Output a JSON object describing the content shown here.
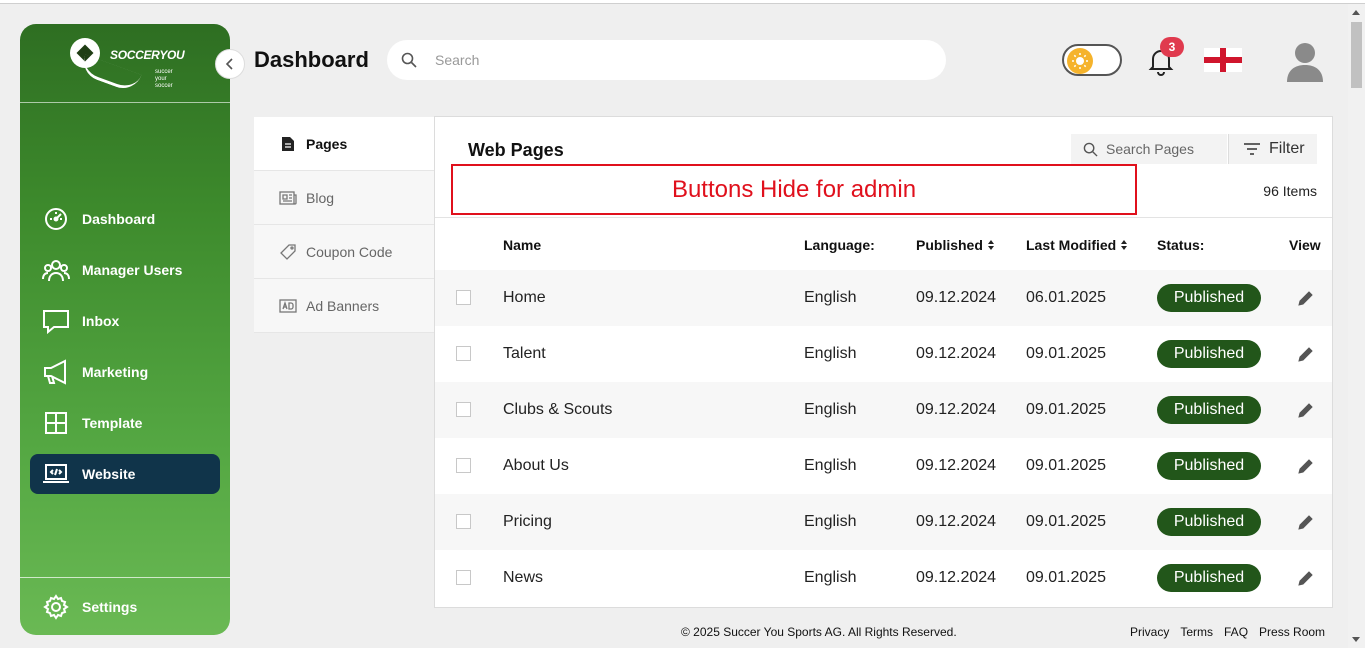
{
  "brand": {
    "logo_text": "SOCCERYOU",
    "tagline": "succer your soccer"
  },
  "sidebar": {
    "items": [
      {
        "label": "Dashboard",
        "icon": "gauge-icon"
      },
      {
        "label": "Manager Users",
        "icon": "users-icon"
      },
      {
        "label": "Inbox",
        "icon": "chat-icon"
      },
      {
        "label": "Marketing",
        "icon": "megaphone-icon"
      },
      {
        "label": "Template",
        "icon": "grid-icon"
      },
      {
        "label": "Website",
        "icon": "code-laptop-icon",
        "active": true
      }
    ],
    "settings_label": "Settings"
  },
  "header": {
    "title": "Dashboard",
    "search_placeholder": "Search",
    "notification_count": "3"
  },
  "subnav": {
    "items": [
      {
        "label": "Pages",
        "icon": "document-icon",
        "active": true
      },
      {
        "label": "Blog",
        "icon": "newspaper-icon"
      },
      {
        "label": "Coupon Code",
        "icon": "tag-icon"
      },
      {
        "label": "Ad Banners",
        "icon": "ad-icon"
      }
    ]
  },
  "panel": {
    "title": "Web Pages",
    "search_placeholder": "Search Pages",
    "filter_label": "Filter",
    "annotation": "Buttons Hide for admin",
    "items_count": "96 Items",
    "columns": {
      "name": "Name",
      "language": "Language:",
      "published": "Published",
      "last_modified": "Last Modified",
      "status": "Status:",
      "view": "View"
    },
    "rows": [
      {
        "name": "Home",
        "language": "English",
        "published": "09.12.2024",
        "last_modified": "06.01.2025",
        "status": "Published"
      },
      {
        "name": "Talent",
        "language": "English",
        "published": "09.12.2024",
        "last_modified": "09.01.2025",
        "status": "Published"
      },
      {
        "name": "Clubs & Scouts",
        "language": "English",
        "published": "09.12.2024",
        "last_modified": "09.01.2025",
        "status": "Published"
      },
      {
        "name": "About Us",
        "language": "English",
        "published": "09.12.2024",
        "last_modified": "09.01.2025",
        "status": "Published"
      },
      {
        "name": "Pricing",
        "language": "English",
        "published": "09.12.2024",
        "last_modified": "09.01.2025",
        "status": "Published"
      },
      {
        "name": "News",
        "language": "English",
        "published": "09.12.2024",
        "last_modified": "09.01.2025",
        "status": "Published"
      }
    ]
  },
  "footer": {
    "copyright": "© 2025 Succer You Sports AG. All Rights Reserved.",
    "links": [
      "Privacy",
      "Terms",
      "FAQ",
      "Press Room"
    ]
  },
  "colors": {
    "sidebar_dark": "#2e6e22",
    "sidebar_light": "#6ab954",
    "active_nav": "#10344a",
    "status_green": "#22561a",
    "annotation_red": "#e0101c",
    "badge_red": "#e03a4e"
  }
}
